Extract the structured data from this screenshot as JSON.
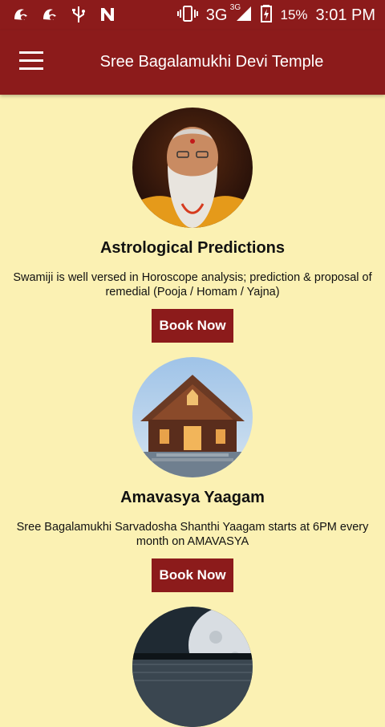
{
  "status_bar": {
    "network": "3G",
    "network_sup": "3G",
    "battery": "15%",
    "time": "3:01 PM",
    "icons": [
      "uc-browser-icon",
      "uc-browser-icon",
      "usb-icon",
      "n-icon",
      "vibrate-icon",
      "signal-icon",
      "battery-icon"
    ]
  },
  "app_bar": {
    "title": "Sree Bagalamukhi Devi Temple",
    "menu_icon": "hamburger-menu-icon",
    "color": "#8C1B1B"
  },
  "services": [
    {
      "title": "Astrological Predictions",
      "description": "Swamiji is well versed in Horoscope analysis; prediction & proposal of remedial (Pooja / Homam / Yajna)",
      "button": "Book Now",
      "image": "swamiji-portrait"
    },
    {
      "title": "Amavasya Yaagam",
      "description": "Sree Bagalamukhi Sarvadosha Shanthi Yaagam starts at 6PM every month on AMAVASYA",
      "button": "Book Now",
      "image": "temple-photo"
    },
    {
      "image": "moon-lake-photo"
    }
  ],
  "colors": {
    "background": "#FBF1B3",
    "accent": "#8C1B1B"
  }
}
